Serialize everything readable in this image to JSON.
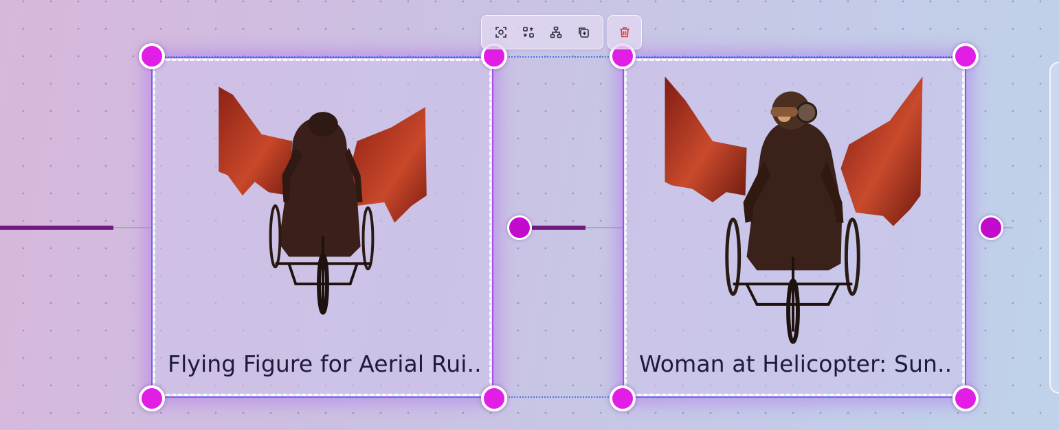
{
  "toolbar": {
    "buttons": [
      {
        "icon": "focus-frame-icon"
      },
      {
        "icon": "regroup-icon"
      },
      {
        "icon": "hierarchy-icon"
      },
      {
        "icon": "duplicate-icon"
      }
    ],
    "delete": {
      "icon": "trash-icon",
      "color": "#e0322f"
    }
  },
  "nodes": [
    {
      "title": "Flying Figure for Aerial Rui..."
    },
    {
      "title": "Woman at Helicopter: Sun..."
    }
  ],
  "colors": {
    "handle": "#e21ee6",
    "port": "#c20acc",
    "active_edge": "#6e1a7f",
    "selection": "#3a7cf0",
    "node_border": "#a84de8"
  }
}
